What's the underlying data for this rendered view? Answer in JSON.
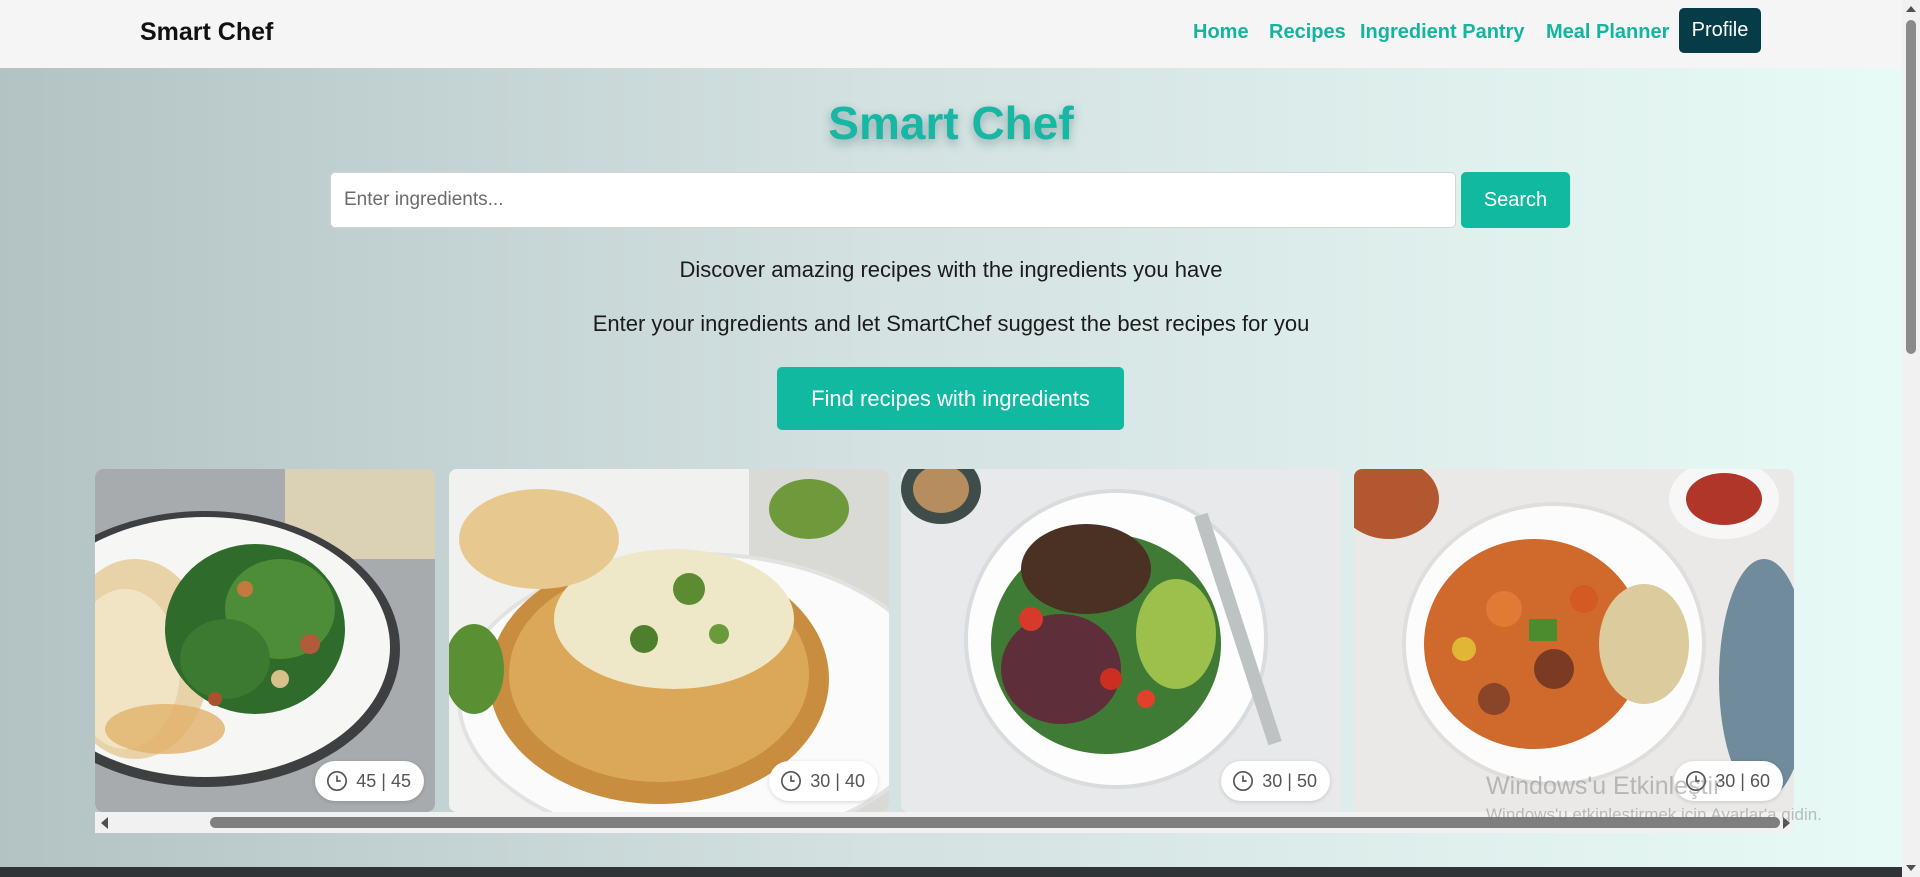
{
  "navbar": {
    "brand": "Smart Chef",
    "links": [
      "Home",
      "Recipes",
      "Ingredient Pantry",
      "Meal Planner"
    ],
    "profile_label": "Profile",
    "link_color": "#16b39e",
    "profile_bg": "#063c47"
  },
  "hero": {
    "title": "Smart Chef",
    "search_placeholder": "Enter ingredients...",
    "search_value": "",
    "search_button": "Search",
    "tagline_1": "Discover amazing recipes with the ingredients you have",
    "tagline_2": "Enter your ingredients and let SmartChef suggest the best recipes for you",
    "cta_button": "Find recipes with ingredients",
    "accent": "#10b9a0"
  },
  "recipes": [
    {
      "photo": "chicken-salad-photo",
      "time": "45 | 45"
    },
    {
      "photo": "bread-bowl-soup-photo",
      "time": "30 | 40"
    },
    {
      "photo": "steak-salad-photo",
      "time": "30 | 50"
    },
    {
      "photo": "sweet-potato-sausage-bowl-photo",
      "time": "30 | 60"
    }
  ],
  "watermark": {
    "line1": "Windows'u Etkinleştir",
    "line2": "Windows'u etkinleştirmek için Ayarlar'a gidin."
  }
}
